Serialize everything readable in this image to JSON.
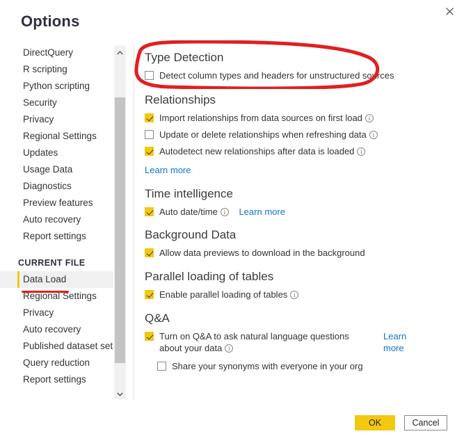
{
  "dialog": {
    "title": "Options",
    "close_label": "Close"
  },
  "sidebar": {
    "global_items": [
      {
        "label": "DirectQuery"
      },
      {
        "label": "R scripting"
      },
      {
        "label": "Python scripting"
      },
      {
        "label": "Security"
      },
      {
        "label": "Privacy"
      },
      {
        "label": "Regional Settings"
      },
      {
        "label": "Updates"
      },
      {
        "label": "Usage Data"
      },
      {
        "label": "Diagnostics"
      },
      {
        "label": "Preview features"
      },
      {
        "label": "Auto recovery"
      },
      {
        "label": "Report settings"
      }
    ],
    "group_title": "CURRENT FILE",
    "current_file_items": [
      {
        "label": "Data Load",
        "selected": true
      },
      {
        "label": "Regional Settings",
        "selected": false
      },
      {
        "label": "Privacy",
        "selected": false
      },
      {
        "label": "Auto recovery",
        "selected": false
      },
      {
        "label": "Published dataset set...",
        "selected": false
      },
      {
        "label": "Query reduction",
        "selected": false
      },
      {
        "label": "Report settings",
        "selected": false
      }
    ]
  },
  "scrollbar": {
    "up_arrow_icon": "chevron-up-icon",
    "down_arrow_icon": "chevron-down-icon"
  },
  "content": {
    "type_detection": {
      "heading": "Type Detection",
      "option": {
        "label": "Detect column types and headers for unstructured sources",
        "checked": false
      }
    },
    "relationships": {
      "heading": "Relationships",
      "options": [
        {
          "label": "Import relationships from data sources on first load",
          "checked": true,
          "info": true
        },
        {
          "label": "Update or delete relationships when refreshing data",
          "checked": false,
          "info": true
        },
        {
          "label": "Autodetect new relationships after data is loaded",
          "checked": true,
          "info": true
        }
      ],
      "learn_more": "Learn more"
    },
    "time_intelligence": {
      "heading": "Time intelligence",
      "option": {
        "label": "Auto date/time",
        "checked": true,
        "info": true
      },
      "learn_more": "Learn more"
    },
    "background_data": {
      "heading": "Background Data",
      "option": {
        "label": "Allow data previews to download in the background",
        "checked": true
      }
    },
    "parallel_loading": {
      "heading": "Parallel loading of tables",
      "option": {
        "label": "Enable parallel loading of tables",
        "checked": true,
        "info": true
      }
    },
    "qna": {
      "heading": "Q&A",
      "option": {
        "label": "Turn on Q&A to ask natural language questions about your data",
        "checked": true,
        "info": true
      },
      "learn_more_line1": "Learn",
      "learn_more_line2": "more",
      "sub_option": {
        "label": "Share your synonyms with everyone in your org",
        "checked": false
      }
    }
  },
  "footer": {
    "ok_label": "OK",
    "cancel_label": "Cancel"
  },
  "annotations": {
    "oval_color": "#e02020",
    "underline_color": "#e02020"
  },
  "colors": {
    "accent_yellow": "#f2c811",
    "link_blue": "#1273cc",
    "selected_bg": "#f0f0f0",
    "text": "#333333",
    "heading": "#3b3b3b"
  }
}
